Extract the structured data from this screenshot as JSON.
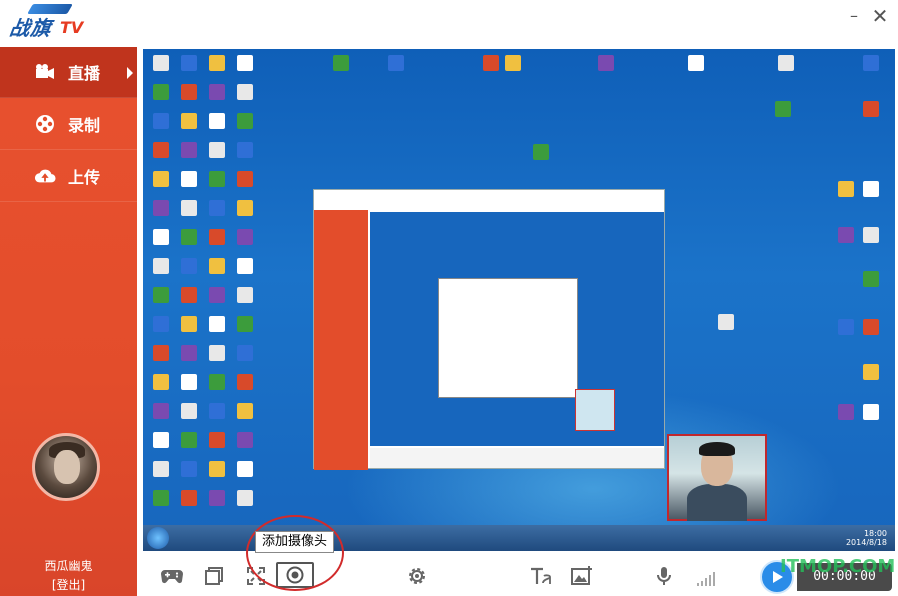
{
  "app": {
    "logo_brand": "战旗",
    "logo_tv": "TV"
  },
  "window_controls": {
    "minimize": "–",
    "close": "✕"
  },
  "sidebar": {
    "items": [
      {
        "label": "直播",
        "icon": "camera-icon",
        "active": true
      },
      {
        "label": "录制",
        "icon": "film-reel-icon",
        "active": false
      },
      {
        "label": "上传",
        "icon": "cloud-upload-icon",
        "active": false
      }
    ],
    "user": {
      "name": "西瓜幽鬼",
      "logout_label": "[登出]"
    }
  },
  "toolbar": {
    "icons": [
      "gamepad-icon",
      "window-icon",
      "fullscreen-capture-icon",
      "camera-add-icon",
      "settings-gear-icon",
      "text-icon",
      "image-add-icon",
      "microphone-icon",
      "volume-level-icon"
    ],
    "tooltip": "添加摄像头",
    "timer": "00:00:00"
  },
  "preview": {
    "taskbar_clock": "18:00\n2014/8/18"
  },
  "watermark": "ITMOP.COM",
  "colors": {
    "sidebar": "#e34d2b",
    "sidebar_active": "#c0341d",
    "desktop": "#1766bd",
    "highlight_circle": "#d12b2b",
    "play_button": "#2a8ce8"
  }
}
